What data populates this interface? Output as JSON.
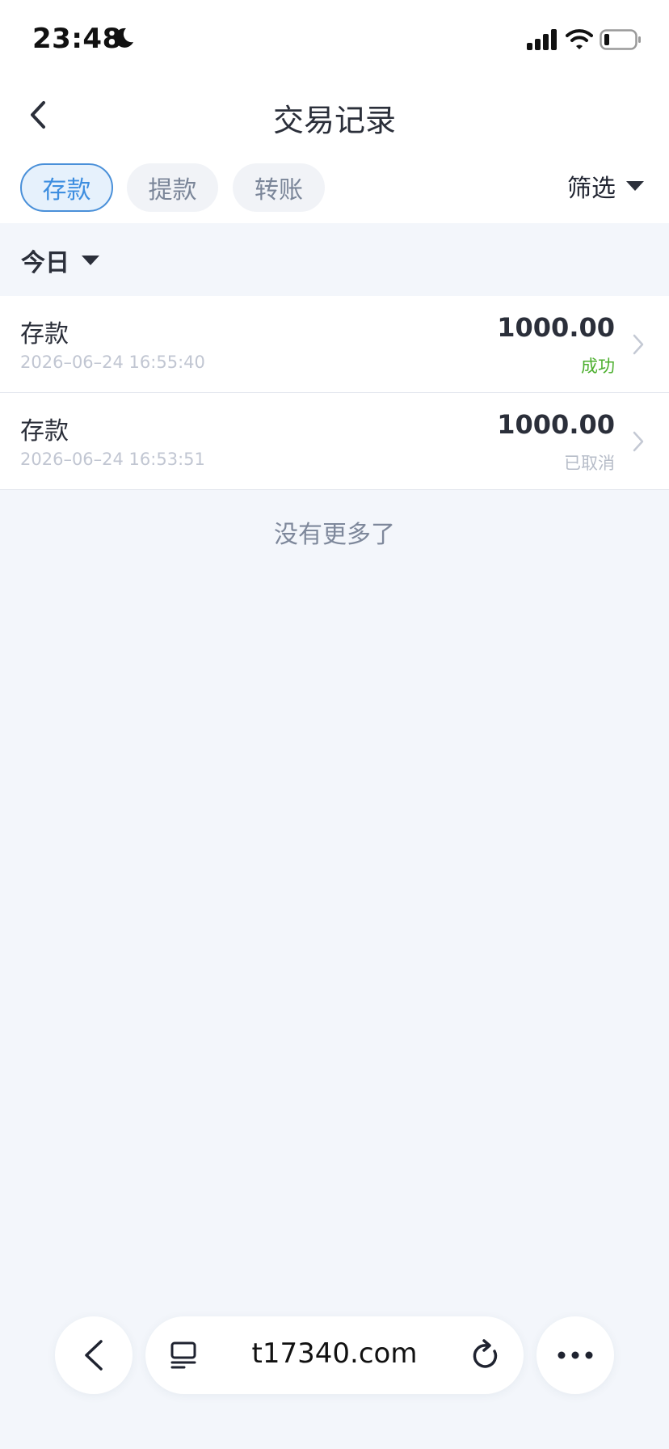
{
  "status_bar": {
    "time": "23:48"
  },
  "header": {
    "title": "交易记录"
  },
  "tabs": [
    {
      "label": "存款",
      "active": true
    },
    {
      "label": "提款",
      "active": false
    },
    {
      "label": "转账",
      "active": false
    }
  ],
  "filter": {
    "label": "筛选"
  },
  "period": {
    "label": "今日"
  },
  "records": [
    {
      "type": "存款",
      "time": "2026–06–24 16:55:40",
      "amount": "1000.00",
      "status": "成功"
    },
    {
      "type": "存款",
      "time": "2026–06–24 16:53:51",
      "amount": "1000.00",
      "status": "已取消"
    }
  ],
  "list_end": {
    "text": "没有更多了"
  },
  "browser": {
    "url": "t17340.com"
  },
  "colors": {
    "accent": "#3d8ee0",
    "success": "#4caf2e",
    "cancelled": "#b6bcc8",
    "page_background": "#f3f6fb"
  },
  "icons": [
    "moon-icon",
    "signal-icon",
    "wifi-icon",
    "battery-icon",
    "back-arrow-icon",
    "caret-down-icon",
    "chevron-right-icon",
    "tabs-icon",
    "reload-icon",
    "more-icon"
  ]
}
